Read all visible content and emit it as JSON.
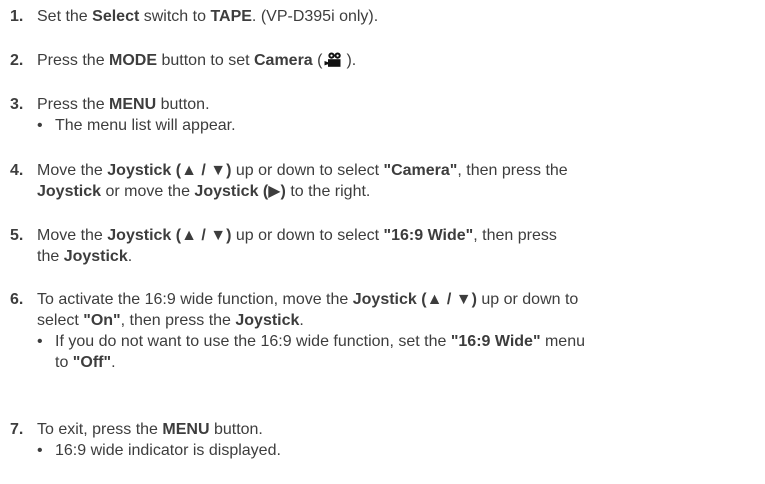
{
  "steps": [
    {
      "num": "1.",
      "p": [
        "Set the ",
        "Select",
        " switch to ",
        "TAPE",
        ". (VP-D395i only)."
      ]
    },
    {
      "num": "2.",
      "p": [
        "Press the ",
        "MODE",
        " button to set ",
        "Camera",
        " (",
        ")."
      ],
      "icon": "camera-mode-icon"
    },
    {
      "num": "3.",
      "p": [
        "Press the ",
        "MENU",
        " button."
      ],
      "bullets": [
        "The menu list will appear."
      ]
    },
    {
      "num": "4.",
      "p": [
        "Move the ",
        "Joystick (▲ / ▼)",
        " up or down to select ",
        "\"Camera\"",
        ", then press the"
      ],
      "p2": [
        "Joystick",
        " or move the ",
        "Joystick (▶)",
        " to the right."
      ]
    },
    {
      "num": "5.",
      "p": [
        "Move the ",
        "Joystick (▲ / ▼)",
        " up or down to select ",
        "\"16:9 Wide\"",
        ", then press"
      ],
      "p2": [
        "the ",
        "Joystick",
        "."
      ]
    },
    {
      "num": "6.",
      "p": [
        "To activate the 16:9 wide function, move the ",
        "Joystick (▲ / ▼)",
        " up or down to"
      ],
      "p2": [
        "select ",
        "\"On\"",
        ", then press the ",
        "Joystick",
        "."
      ],
      "bullet6": [
        "If you do not want to use the 16:9 wide function, set the ",
        "\"16:9 Wide\"",
        " menu"
      ],
      "bullet6b": [
        "to ",
        "\"Off\"",
        "."
      ]
    },
    {
      "num": "7.",
      "p": [
        "To exit, press the ",
        "MENU",
        " button."
      ],
      "bullets": [
        "16:9 wide indicator is displayed."
      ]
    }
  ],
  "bullet_char": "•"
}
